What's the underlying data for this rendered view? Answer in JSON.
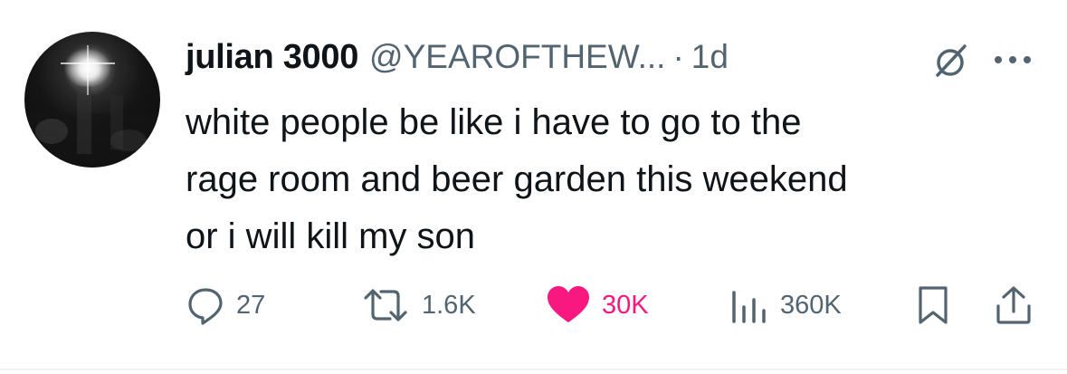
{
  "tweet": {
    "display_name": "julian 3000",
    "handle": "@YEAROFTHEW...",
    "separator": "·",
    "time": "1d",
    "text": "white people be like i have to go to the\nrage room and beer garden this weekend\nor i will kill my son",
    "icons": {
      "avatar": "avatar",
      "grok": "grok-icon",
      "more": "more-icon"
    }
  },
  "actions": {
    "replies": {
      "icon": "reply-icon",
      "count": "27"
    },
    "reposts": {
      "icon": "repost-icon",
      "count": "1.6K"
    },
    "likes": {
      "icon": "heart-icon",
      "count": "30K",
      "liked": true
    },
    "views": {
      "icon": "views-icon",
      "count": "360K"
    },
    "bookmark": {
      "icon": "bookmark-icon"
    },
    "share": {
      "icon": "share-icon"
    }
  },
  "colors": {
    "text_primary": "#0f1419",
    "text_secondary": "#536471",
    "like_active": "#f91880"
  }
}
